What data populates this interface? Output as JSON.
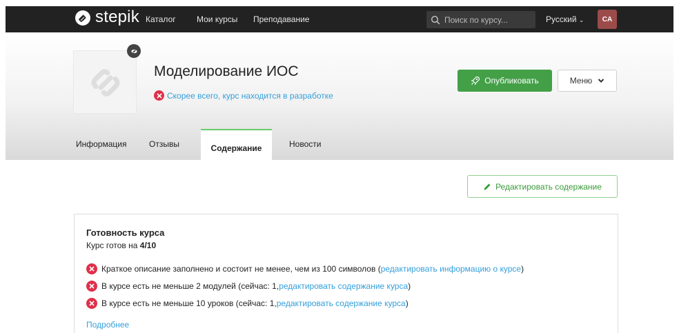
{
  "navbar": {
    "logo_text": "stepik",
    "links": [
      "Каталог",
      "Мои курсы",
      "Преподавание"
    ],
    "search_placeholder": "Поиск по курсу...",
    "language": "Русский",
    "avatar_initials": "CA",
    "avatar_color": "#9c4b4b"
  },
  "course": {
    "title": "Моделирование ИОС",
    "status_text": "Скорее всего, курс находится в разработке",
    "publish_label": "Опубликовать",
    "menu_label": "Меню"
  },
  "tabs": [
    {
      "label": "Информация",
      "active": false
    },
    {
      "label": "Отзывы",
      "active": false
    },
    {
      "label": "Содержание",
      "active": true
    },
    {
      "label": "Новости",
      "active": false
    }
  ],
  "edit_content_label": "Редактировать содержание",
  "readiness": {
    "title": "Готовность курса",
    "summary_prefix": "Курс готов на",
    "summary_value": "4/10",
    "requirements": [
      {
        "text": "Краткое описание заполнено и состоит не менее, чем из 100 символов (",
        "link": "редактировать информацию о курсе",
        "suffix": ")",
        "met": false
      },
      {
        "text": "В курсе есть не меньше 2 модулей (сейчас: 1, ",
        "link": "редактировать содержание курса",
        "suffix": ")",
        "met": false
      },
      {
        "text": "В курсе есть не меньше 10 уроков (сейчас: 1, ",
        "link": "редактировать содержание курса",
        "suffix": ")",
        "met": false
      }
    ],
    "more_label": "Подробнее"
  },
  "colors": {
    "navbar_bg": "#222222",
    "publish_green": "#43a047",
    "link_blue": "#339fdb",
    "error_red": "#e0304a",
    "tab_accent": "#66cc66"
  }
}
